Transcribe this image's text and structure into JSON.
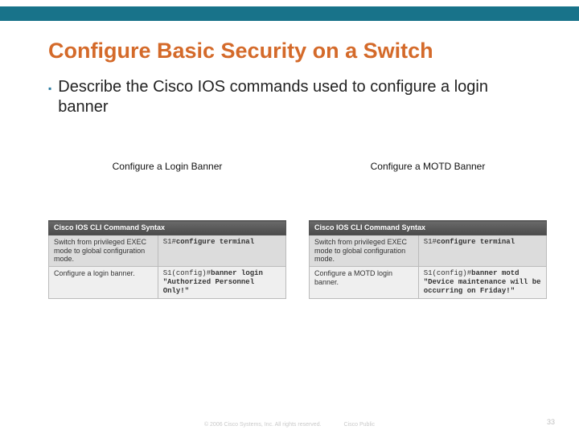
{
  "title": "Configure Basic Security on a Switch",
  "bullet": "Describe the Cisco IOS commands used to configure a login banner",
  "panels": [
    {
      "title": "Configure a Login Banner",
      "table_header": "Cisco IOS CLI Command Syntax",
      "rows": [
        {
          "desc": "Switch from privileged EXEC mode to global configuration mode.",
          "prompt": "S1#",
          "cmd": "configure terminal"
        },
        {
          "desc": "Configure a login banner.",
          "prompt": "S1(config)#",
          "cmd": "banner login \"Authorized Personnel Only!\""
        }
      ]
    },
    {
      "title": "Configure a MOTD Banner",
      "table_header": "Cisco IOS CLI Command Syntax",
      "rows": [
        {
          "desc": "Switch from privileged EXEC mode to global configuration mode.",
          "prompt": "S1#",
          "cmd": "configure terminal"
        },
        {
          "desc": "Configure a MOTD login banner.",
          "prompt": "S1(config)#",
          "cmd": "banner motd \"Device maintenance will be occurring on Friday!\""
        }
      ]
    }
  ],
  "footer": {
    "copyright": "© 2006 Cisco Systems, Inc. All rights reserved.",
    "label": "Cisco Public",
    "page": "33"
  }
}
